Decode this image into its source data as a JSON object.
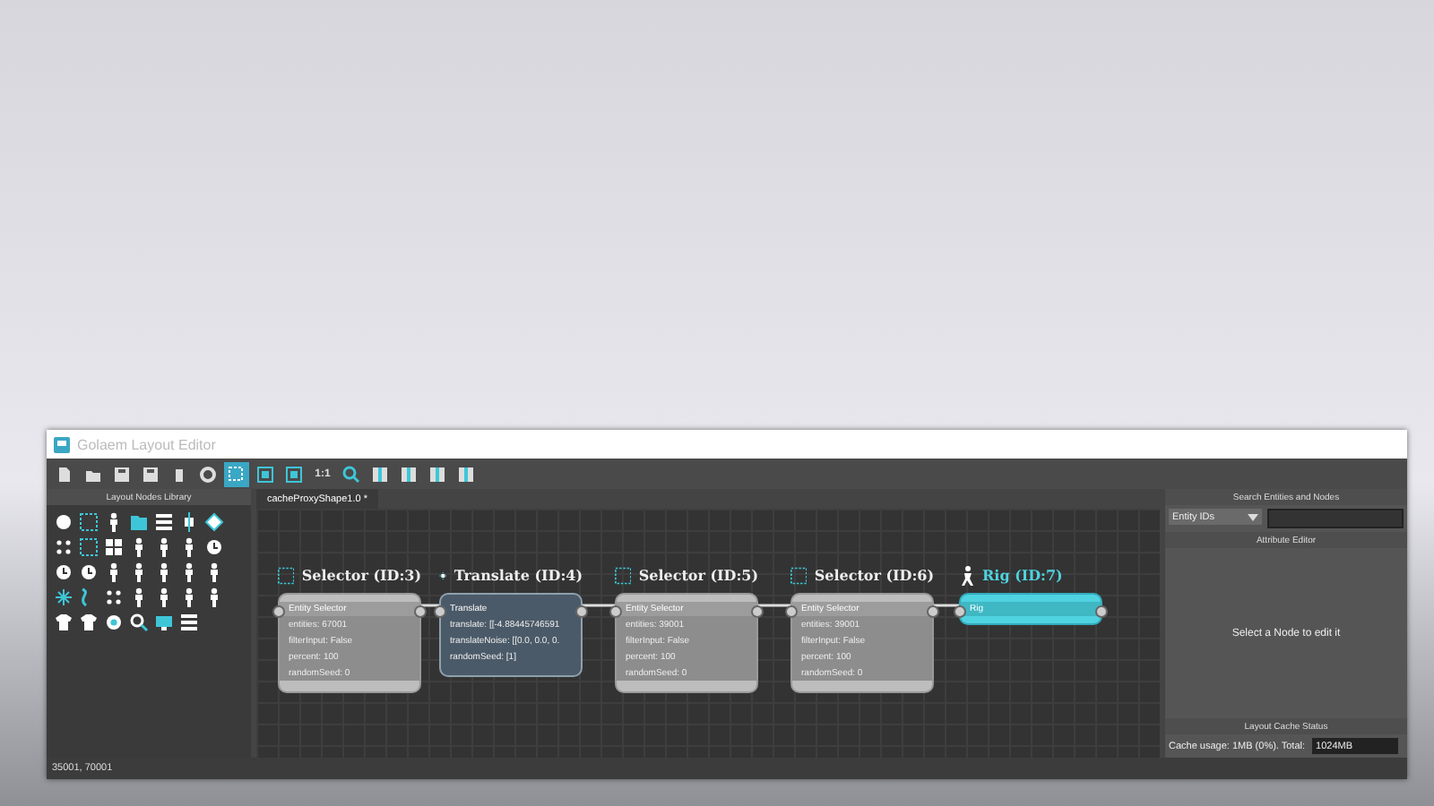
{
  "window": {
    "title": "Golaem Layout Editor"
  },
  "toolbar": {
    "zoom_label": "1:1"
  },
  "library": {
    "title": "Layout Nodes Library"
  },
  "editor": {
    "tab": {
      "label": "cacheProxyShape1.0 *",
      "selected": true
    },
    "nodes": [
      {
        "kind": "selector",
        "title": "Selector (ID:3)",
        "header": "Entity Selector",
        "fields": [
          "entities: 67001",
          "filterInput: False",
          "percent: 100",
          "randomSeed: 0"
        ]
      },
      {
        "kind": "translate",
        "title": "Translate (ID:4)",
        "header": "Translate",
        "fields": [
          "translate: [[-4.88445746591",
          "translateNoise: [[0.0, 0.0, 0.",
          "randomSeed: [1]"
        ]
      },
      {
        "kind": "selector",
        "title": "Selector (ID:5)",
        "header": "Entity Selector",
        "fields": [
          "entities: 39001",
          "filterInput: False",
          "percent: 100",
          "randomSeed: 0"
        ]
      },
      {
        "kind": "selector",
        "title": "Selector (ID:6)",
        "header": "Entity Selector",
        "fields": [
          "entities: 39001",
          "filterInput: False",
          "percent: 100",
          "randomSeed: 0"
        ]
      },
      {
        "kind": "rig",
        "title": "Rig (ID:7)",
        "header": "Rig"
      }
    ]
  },
  "search_panel": {
    "title": "Search Entities and Nodes",
    "filter": "Entity IDs"
  },
  "attribute_editor": {
    "title": "Attribute Editor",
    "message": "Select a Node to edit it"
  },
  "cache_status": {
    "title": "Layout Cache Status",
    "usage": "Cache usage: 1MB (0%). Total:",
    "total": "1024MB"
  },
  "status_bar": "35001, 70001"
}
